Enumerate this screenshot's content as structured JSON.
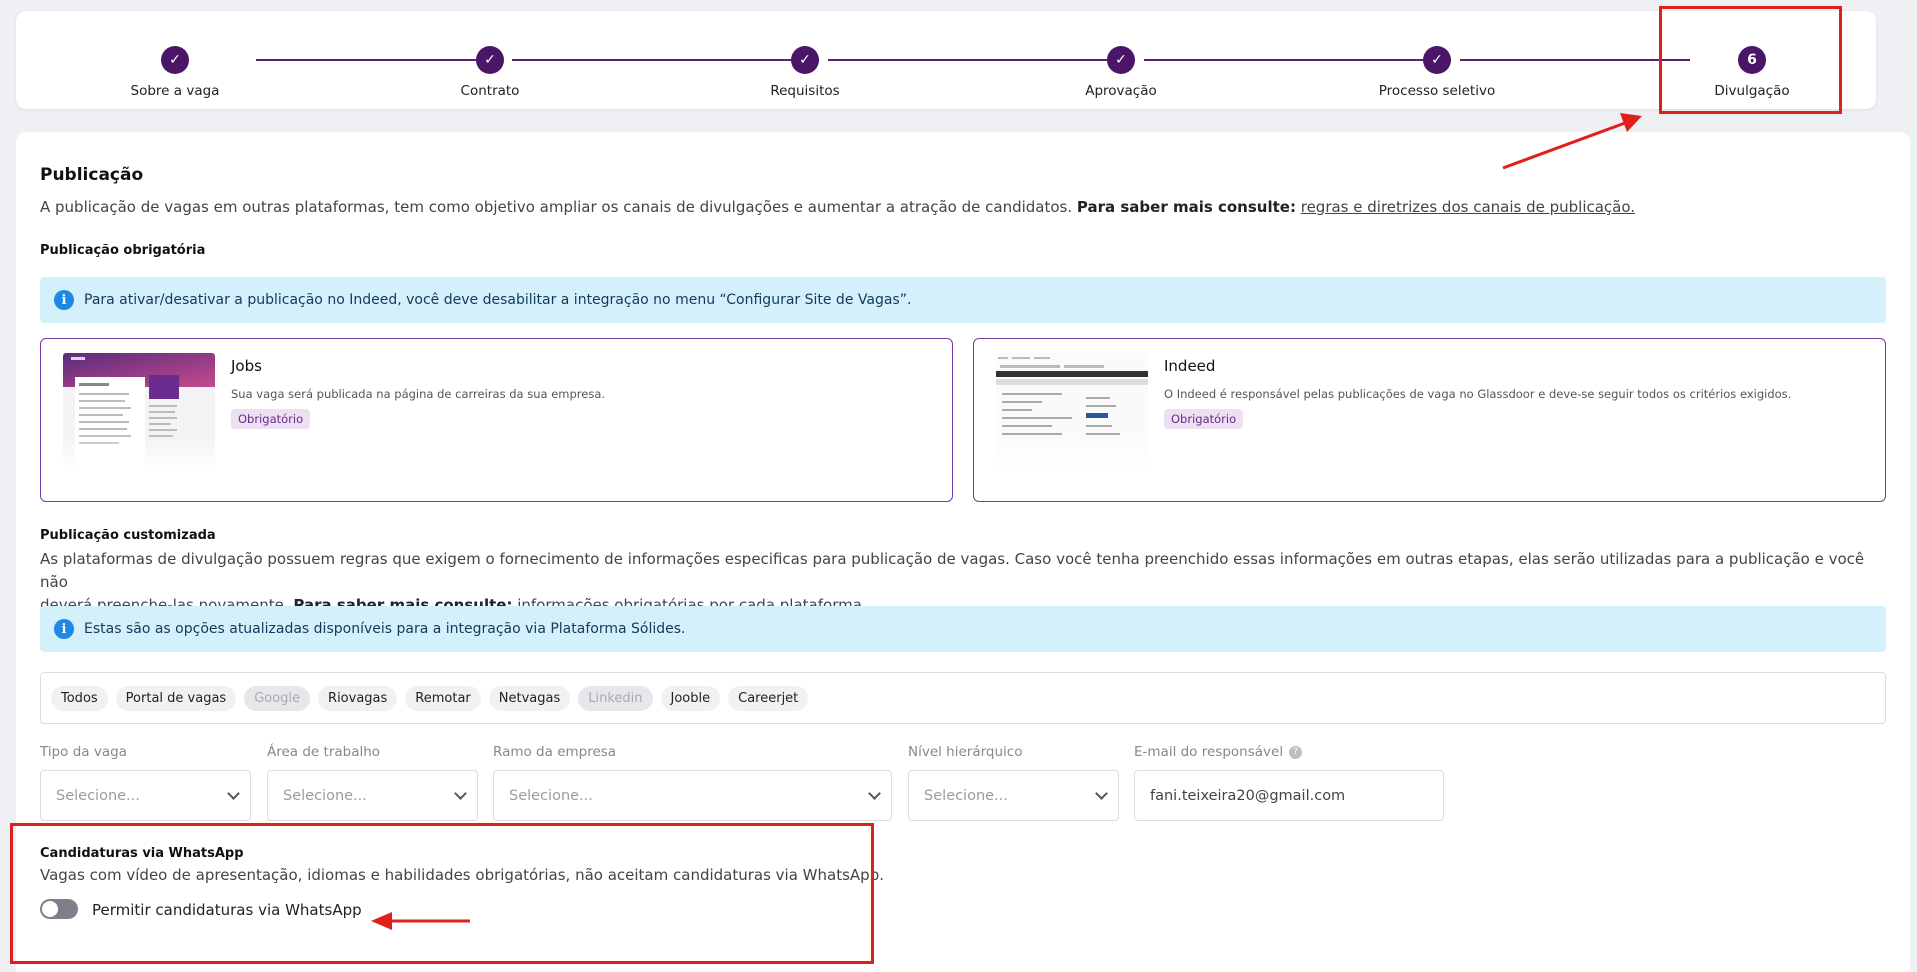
{
  "stepper": {
    "steps": [
      {
        "label": "Sobre a vaga",
        "marker": "✓"
      },
      {
        "label": "Contrato",
        "marker": "✓"
      },
      {
        "label": "Requisitos",
        "marker": "✓"
      },
      {
        "label": "Aprovação",
        "marker": "✓"
      },
      {
        "label": "Processo seletivo",
        "marker": "✓"
      },
      {
        "label": "Divulgação",
        "marker": "6"
      }
    ],
    "accent_color": "#4b1668"
  },
  "publicacao": {
    "title": "Publicação",
    "description": "A publicação de vagas em outras plataformas, tem como objetivo ampliar os canais de divulgações e aumentar a atração de candidatos.",
    "more_label": "Para saber mais consulte:",
    "more_link": "regras e diretrizes dos canais de publicação."
  },
  "obrigatoria": {
    "title": "Publicação obrigatória",
    "info": "Para ativar/desativar a publicação no Indeed, você deve desabilitar a integração no menu “Configurar Site de Vagas”.",
    "cards": [
      {
        "name": "Jobs",
        "description": "Sua vaga será publicada na página de carreiras da sua empresa.",
        "badge": "Obrigatório"
      },
      {
        "name": "Indeed",
        "description": "O Indeed é responsável pelas publicações de vaga no Glassdoor e deve-se seguir todos os critérios exigidos.",
        "badge": "Obrigatório"
      }
    ]
  },
  "customizada": {
    "title": "Publicação customizada",
    "description_1": "As plataformas de divulgação possuem regras que exigem o fornecimento de informações especificas para publicação de vagas. Caso você tenha preenchido essas informações em outras etapas, elas serão utilizadas para a publicação e você não",
    "description_2": "deverá preenche-las novamente.",
    "more_label": "Para saber mais consulte:",
    "more_link": "informações obrigatórias por cada plataforma.",
    "info": "Estas são as opções atualizadas disponíveis para a integração via Plataforma Sólides.",
    "chips": [
      "Todos",
      "Portal de vagas",
      "Google",
      "Riovagas",
      "Remotar",
      "Netvagas",
      "Linkedin",
      "Jooble",
      "Careerjet"
    ],
    "fields": {
      "tipo": {
        "label": "Tipo da vaga",
        "placeholder": "Selecione..."
      },
      "area": {
        "label": "Área de trabalho",
        "placeholder": "Selecione..."
      },
      "ramo": {
        "label": "Ramo da empresa",
        "placeholder": "Selecione..."
      },
      "nivel": {
        "label": "Nível hierárquico",
        "placeholder": "Selecione..."
      },
      "email": {
        "label": "E-mail do responsável",
        "value": "fani.teixeira20@gmail.com"
      }
    }
  },
  "whatsapp": {
    "title": "Candidaturas via WhatsApp",
    "description": "Vagas com vídeo de apresentação, idiomas e habilidades obrigatórias, não aceitam candidaturas via WhatsApp.",
    "toggle_label": "Permitir candidaturas via WhatsApp",
    "toggle_on": false
  },
  "colors": {
    "annotation": "#e0201c",
    "info_bg": "#d3f0fb",
    "card_border": "#7b3aa5"
  }
}
